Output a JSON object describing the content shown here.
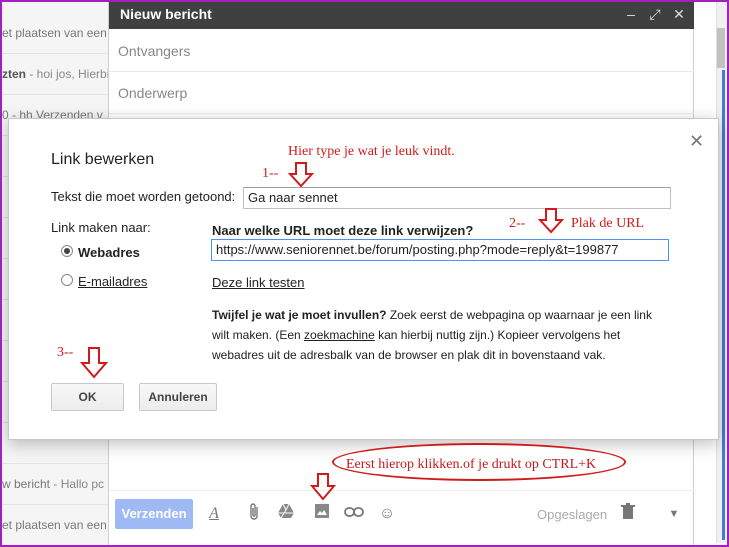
{
  "inbox": [
    {
      "text": "et plaatsen van een",
      "snippet": "",
      "bold": false
    },
    {
      "text": "zten",
      "snippet": " - hoi jos, Hierbi",
      "bold": true
    },
    {
      "text": "0 - hh Verzenden v",
      "snippet": "",
      "bold": false
    },
    {
      "text": "",
      "snippet": "",
      "bold": false
    },
    {
      "text": "",
      "snippet": "",
      "bold": false
    },
    {
      "text": "",
      "snippet": "",
      "bold": false
    },
    {
      "text": "",
      "snippet": "",
      "bold": false
    },
    {
      "text": "",
      "snippet": "",
      "bold": false
    },
    {
      "text": "",
      "snippet": "",
      "bold": false
    },
    {
      "text": "",
      "snippet": "",
      "bold": false
    },
    {
      "text": "",
      "snippet": "",
      "bold": false
    },
    {
      "text": "w bericht",
      "snippet": " - Hallo pc",
      "bold": false
    },
    {
      "text": "et plaatsen van een",
      "snippet": "",
      "bold": false
    }
  ],
  "compose": {
    "title": "Nieuw bericht",
    "recipients_placeholder": "Ontvangers",
    "subject_placeholder": "Onderwerp",
    "send_label": "Verzenden",
    "saved_label": "Opgeslagen"
  },
  "modal": {
    "title": "Link bewerken",
    "display_text_label": "Tekst die moet worden getoond:",
    "display_text_value": "Ga naar sennet",
    "link_to_label": "Link maken naar:",
    "option_web": "Webadres",
    "option_email": "E-mailadres",
    "url_question": "Naar welke URL moet deze link verwijzen?",
    "url_value": "https://www.seniorennet.be/forum/posting.php?mode=reply&t=199877",
    "test_link": "Deze link testen",
    "help_bold": "Twijfel je wat je moet invullen?",
    "help_part1": " Zoek eerst de webpagina op waarnaar je een link wilt maken. (Een ",
    "help_link": "zoekmachine",
    "help_part2": " kan hierbij nuttig zijn.) Kopieer vervolgens het webadres uit de adresbalk van de browser en plak dit in bovenstaand vak.",
    "ok_label": "OK",
    "cancel_label": "Annuleren"
  },
  "annotations": {
    "step1_note": "Hier type je wat je leuk vindt.",
    "step1_num": "1--",
    "step2_num": "2--",
    "step2_note": "Plak de URL",
    "step3_num": "3--",
    "first_click": "Eerst hierop klikken.of je drukt op CTRL+K"
  },
  "colors": {
    "annotation": "#d11a1a",
    "header_bg": "#404040",
    "send_bg": "#9fb9f5",
    "frame": "#a020c0"
  }
}
